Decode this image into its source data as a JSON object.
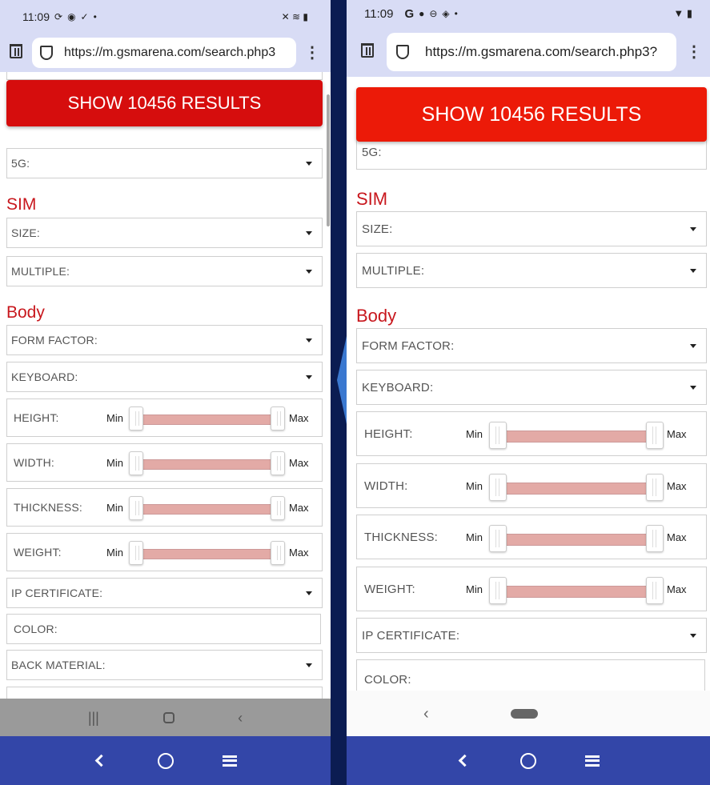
{
  "status": {
    "time": "11:09"
  },
  "browser": {
    "left_url": "https://m.gsmarena.com/search.php3",
    "right_url": "https://m.gsmarena.com/search.php3?"
  },
  "show_results_label": "SHOW 10456 RESULTS",
  "fields": {
    "fiveg": "5G:",
    "sim_size": "SIZE:",
    "multiple": "MULTIPLE:",
    "form_factor": "FORM FACTOR:",
    "keyboard": "KEYBOARD:",
    "ip_certificate": "IP CERTIFICATE:",
    "color": "COLOR:",
    "back_material": "BACK MATERIAL:"
  },
  "sections": {
    "sim": "SIM",
    "body": "Body"
  },
  "sliders": [
    {
      "key": "height",
      "label": "HEIGHT:",
      "min_label": "Min",
      "max_label": "Max"
    },
    {
      "key": "width",
      "label": "WIDTH:",
      "min_label": "Min",
      "max_label": "Max"
    },
    {
      "key": "thickness",
      "label": "THICKNESS:",
      "min_label": "Min",
      "max_label": "Max"
    },
    {
      "key": "weight",
      "label": "WEIGHT:",
      "min_label": "Min",
      "max_label": "Max"
    }
  ],
  "colors": {
    "accent_red": "#d60d0d",
    "section_red": "#c8171d",
    "nav_blue": "#3346a8",
    "status_bg": "#d8dcf5",
    "track": "#e3aaa6"
  }
}
